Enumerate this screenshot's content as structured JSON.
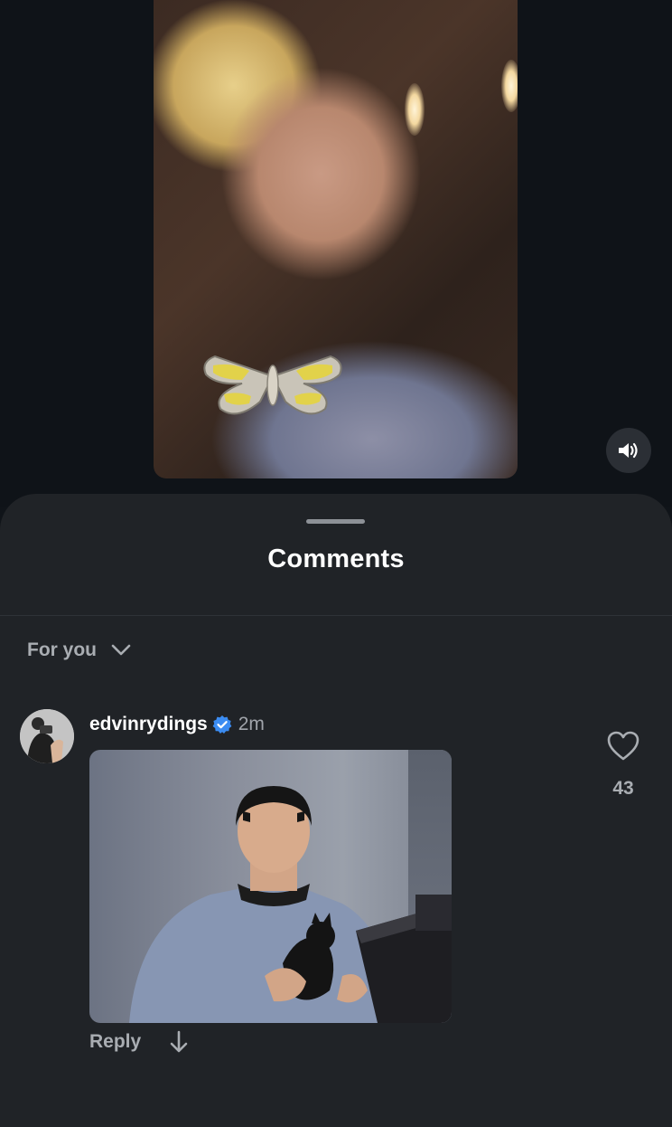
{
  "video": {
    "mute_icon": "speaker-volume-icon"
  },
  "comments_sheet": {
    "title": "Comments",
    "sort": {
      "selected": "For you",
      "icon": "chevron-down-icon"
    },
    "comments": [
      {
        "username": "edvinrydings",
        "verified": true,
        "timestamp": "2m",
        "like_count": "43",
        "reply_label": "Reply",
        "like_icon": "heart-outline-icon",
        "expand_icon": "arrow-down-icon"
      }
    ]
  },
  "colors": {
    "background": "#101419",
    "sheet": "#202327",
    "primary_text": "#ffffff",
    "secondary_text": "#a9adb2",
    "verified_badge": "#3b8cf2"
  }
}
